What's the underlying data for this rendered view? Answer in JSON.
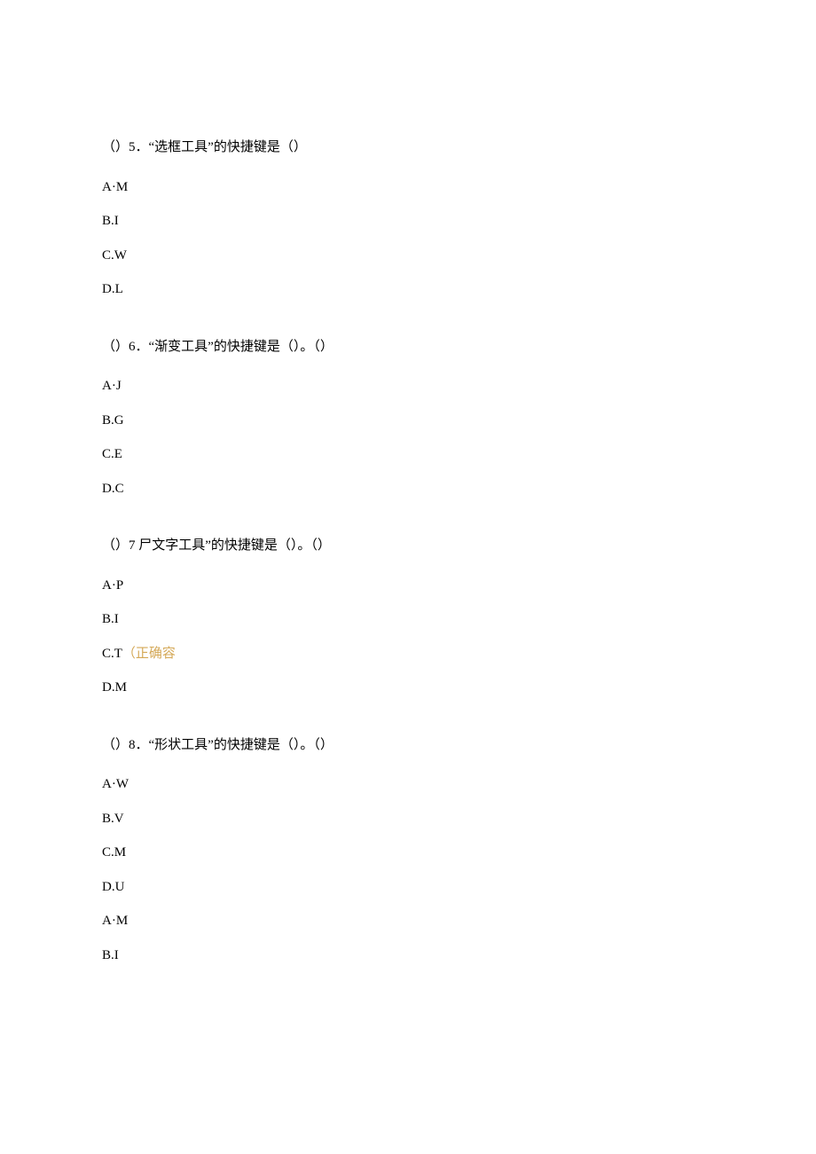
{
  "questions": [
    {
      "prompt": "（）5．“选框工具”的快捷键是（）",
      "options": [
        {
          "text": "A·M"
        },
        {
          "text": "B.I"
        },
        {
          "text": "C.W"
        },
        {
          "text": "D.L"
        }
      ]
    },
    {
      "prompt": "（）6．“渐变工具”的快捷键是（）。（）",
      "options": [
        {
          "text": "A·J"
        },
        {
          "text": "B.G"
        },
        {
          "text": "C.E"
        },
        {
          "text": "D.C"
        }
      ]
    },
    {
      "prompt": "（）7 尸文字工具”的快捷键是（）。（）",
      "options": [
        {
          "text": "A·P"
        },
        {
          "text": "B.I"
        },
        {
          "prefix": "C.T",
          "hint": "（正确容"
        },
        {
          "text": "D.M"
        }
      ]
    },
    {
      "prompt": "（）8．“形状工具”的快捷键是（）。（）",
      "options": [
        {
          "text": "A·W"
        },
        {
          "text": "B.V"
        },
        {
          "text": "C.M"
        },
        {
          "text": "D.U"
        },
        {
          "text": "A·M"
        },
        {
          "text": "B.I"
        }
      ]
    }
  ]
}
